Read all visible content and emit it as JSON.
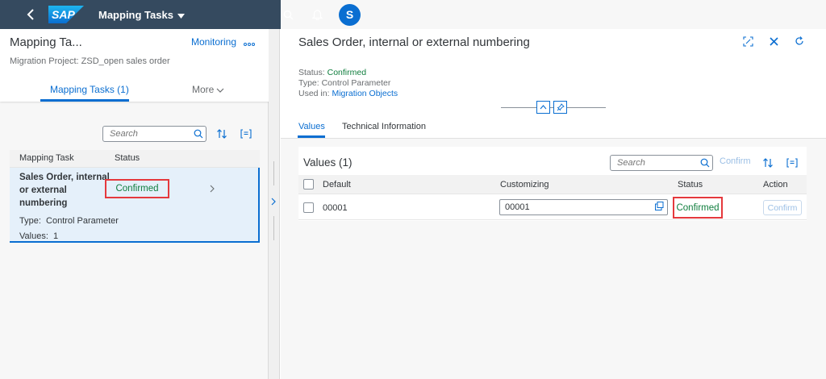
{
  "shell": {
    "app_title": "Mapping Tasks",
    "logo_text": "SAP",
    "avatar_initial": "S",
    "colors": {
      "bar": "#354a5f",
      "accent": "#0a6ed1"
    }
  },
  "left": {
    "title": "Mapping Ta...",
    "monitoring_link": "Monitoring",
    "project": "Migration Project: ZSD_open sales order",
    "tab_label": "Mapping Tasks (1)",
    "more_label": "More",
    "search_placeholder": "Search",
    "columns": {
      "task": "Mapping Task",
      "status": "Status"
    },
    "rows": [
      {
        "task": "Sales Order, internal or external numbering",
        "status": "Confirmed",
        "type_label": "Type:",
        "type_value": "Control Parameter",
        "values_label": "Values:",
        "values_count": "1"
      }
    ]
  },
  "detail": {
    "title": "Sales Order, internal or external numbering",
    "status_label": "Status:",
    "status_value": "Confirmed",
    "type_line": "Type: Control Parameter",
    "used_in_label": "Used in:",
    "used_in_link": "Migration Objects",
    "tabs": [
      {
        "label": "Values",
        "selected": true
      },
      {
        "label": "Technical Information",
        "selected": false
      }
    ],
    "values_card": {
      "title": "Values (1)",
      "search_placeholder": "Search",
      "confirm_label": "Confirm",
      "columns": {
        "default": "Default",
        "customizing": "Customizing",
        "status": "Status",
        "action": "Action"
      },
      "rows": [
        {
          "default": "00001",
          "customizing": "00001",
          "status": "Confirmed",
          "action": "Confirm"
        }
      ]
    }
  },
  "status_colors": {
    "confirmed": "#107e3e",
    "highlight": "#e5393d"
  }
}
